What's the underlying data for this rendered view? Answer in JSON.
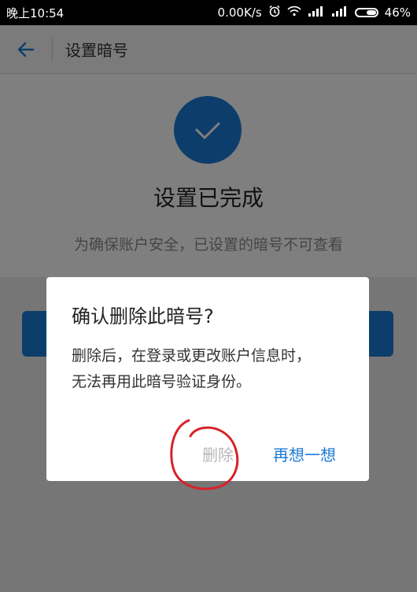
{
  "status_bar": {
    "time": "晚上10:54",
    "net_speed": "0.00K/s",
    "battery": "46%"
  },
  "app_bar": {
    "title": "设置暗号"
  },
  "content": {
    "done_title": "设置已完成",
    "done_subtitle": "为确保账户安全，已设置的暗号不可查看"
  },
  "dialog": {
    "title": "确认删除此暗号?",
    "message_line1": "删除后，在登录或更改账户信息时，",
    "message_line2": "无法再用此暗号验证身份。",
    "delete_label": "删除",
    "rethink_label": "再想一想"
  },
  "colors": {
    "accent": "#1b7ad6",
    "annotation": "#d8222a"
  }
}
